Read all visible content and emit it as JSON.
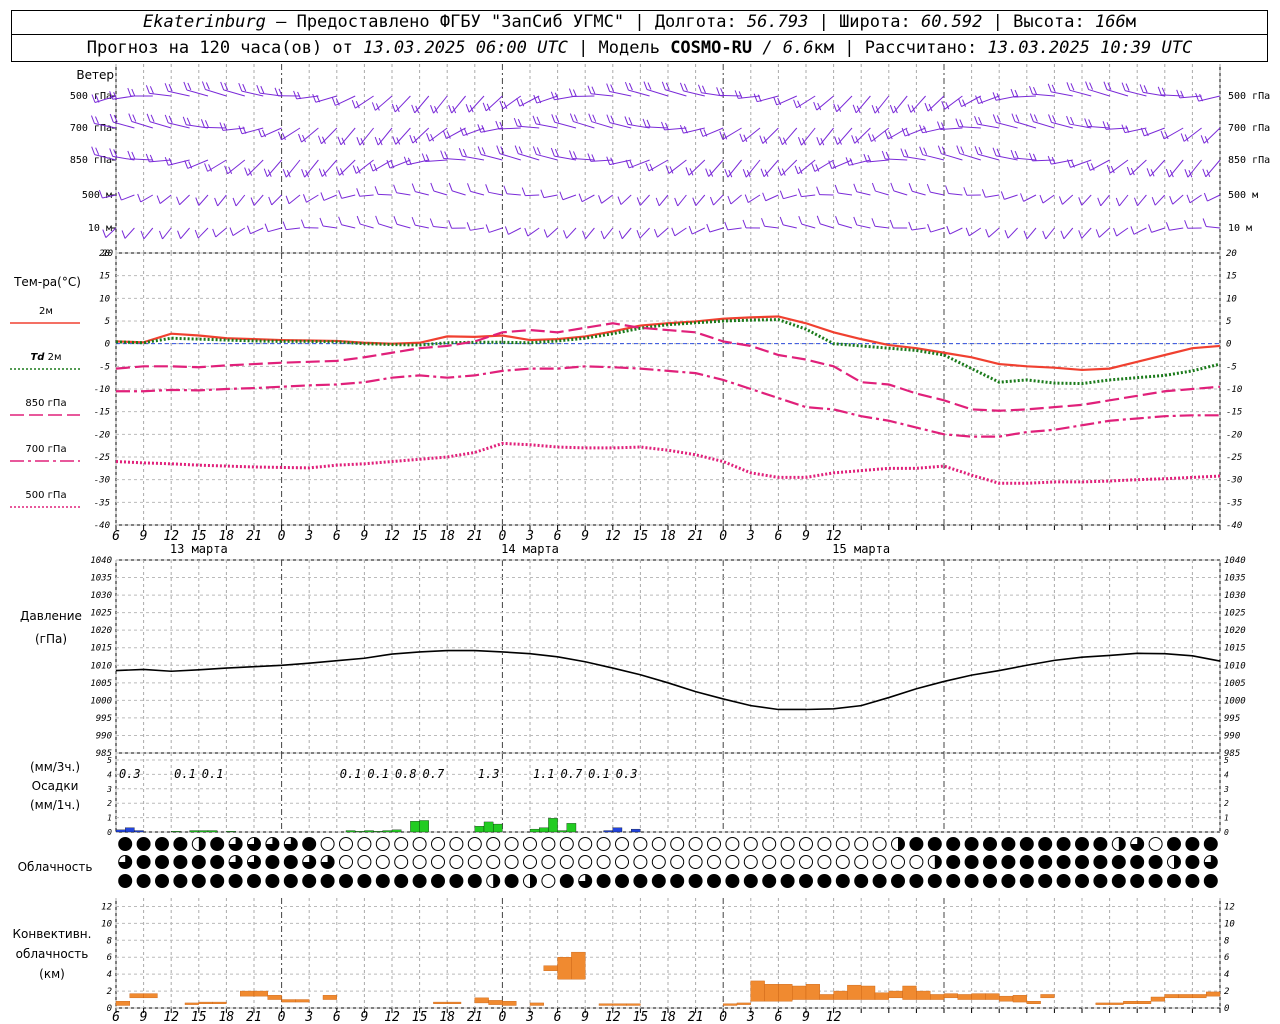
{
  "header": {
    "station": "Ekaterinburg",
    "provider": " – Предоставлено ФГБУ \"ЗапСиб УГМС\" ",
    "lon_label": "| Долгота: ",
    "lon": "56.793",
    "lat_label": " | Широта: ",
    "lat": "60.592",
    "alt_label": " | Высота: ",
    "alt": "166",
    "alt_unit": "м",
    "forecast_label": "Прогноз на 120 часа(ов) от ",
    "forecast_from": "13.03.2025 06:00 UTC",
    "model_label": "  | Модель ",
    "model": "COSMO-RU",
    "res": " / 6.6",
    "res_unit": "км",
    "calc_label": " | Рассчитано: ",
    "calc": "13.03.2025 10:39 UTC"
  },
  "labels": {
    "wind": "Ветер",
    "wind_levels": [
      "500 гПа",
      "700 гПа",
      "850 гПа",
      "500 м",
      "10 м"
    ],
    "temp": "Тем-ра(°С)",
    "t2m": "2м",
    "td": "Td",
    "td2m": "2м",
    "t850": "850 гПа",
    "t700": "700 гПа",
    "t500": "500 гПа",
    "pressure": "Давление",
    "pressure_unit": "(гПа)",
    "precip_unit1": "(мм/3ч.)",
    "precip": "Осадки",
    "precip_unit2": "(мм/1ч.)",
    "cloud": "Облачность",
    "conv1": "Конвективн.",
    "conv2": "облачность",
    "conv3": "(км)"
  },
  "time_axis": {
    "hour_ticks": [
      "6",
      "9",
      "12",
      "15",
      "18",
      "21",
      "0",
      "3",
      "6",
      "9",
      "12",
      "15",
      "18",
      "21",
      "0",
      "3",
      "6",
      "9",
      "12",
      "15",
      "18",
      "21",
      "0",
      "3",
      "6",
      "9",
      "12"
    ],
    "dates": [
      "13 марта",
      "14 марта",
      "15 марта"
    ]
  },
  "chart_data": [
    {
      "type": "line",
      "title": "Тем-ра(°С)",
      "ylim": [
        -40,
        20
      ],
      "yticks": [
        "20",
        "15",
        "10",
        "5",
        "0",
        "-5",
        "-10",
        "-15",
        "-20",
        "-25",
        "-30",
        "-35",
        "-40"
      ],
      "x_hours": [
        0,
        3,
        6,
        9,
        12,
        15,
        18,
        21,
        24,
        27,
        30,
        33,
        36,
        39,
        42,
        45,
        48,
        51,
        54,
        57,
        60,
        63,
        66,
        69,
        72,
        75,
        78,
        81,
        84,
        87,
        90,
        93,
        96,
        99,
        102,
        105,
        108,
        111,
        114,
        117,
        120
      ],
      "series": [
        {
          "name": "2м",
          "color": "#f04030",
          "style": "solid",
          "values": [
            0.5,
            0.3,
            2.2,
            1.8,
            1.2,
            1.0,
            0.8,
            0.7,
            0.6,
            0.2,
            0.0,
            0.2,
            1.6,
            1.5,
            1.8,
            0.8,
            1.0,
            1.6,
            2.7,
            4.0,
            4.5,
            4.9,
            5.5,
            5.8,
            6.0,
            4.5,
            2.5,
            1.0,
            -0.3,
            -1.0,
            -2.0,
            -3.0,
            -4.5,
            -5.0,
            -5.3,
            -5.8,
            -5.5,
            -4.0,
            -2.5,
            -1.0,
            -0.5
          ]
        },
        {
          "name": "Td 2м",
          "color": "#1a7a1a",
          "style": "dotted",
          "values": [
            0.4,
            0.2,
            1.2,
            1.0,
            0.8,
            0.6,
            0.5,
            0.5,
            0.4,
            0.0,
            -0.2,
            -0.3,
            0.2,
            0.3,
            0.3,
            0.2,
            0.6,
            1.2,
            2.2,
            3.4,
            4.2,
            4.6,
            5.0,
            5.2,
            5.3,
            3.2,
            0.0,
            -0.5,
            -1.0,
            -1.5,
            -2.5,
            -5.5,
            -8.5,
            -8.0,
            -8.7,
            -8.8,
            -8.0,
            -7.5,
            -7.0,
            -6.0,
            -4.5
          ]
        },
        {
          "name": "850 гПа",
          "color": "#e0207a",
          "style": "longdash",
          "values": [
            -5.5,
            -5.0,
            -5.0,
            -5.2,
            -4.8,
            -4.5,
            -4.2,
            -4.0,
            -3.8,
            -3.0,
            -2.0,
            -1.0,
            -0.5,
            0.5,
            2.5,
            3.0,
            2.5,
            3.5,
            4.5,
            3.5,
            3.0,
            2.5,
            0.5,
            -0.5,
            -2.5,
            -3.5,
            -5.0,
            -8.5,
            -9.0,
            -11.0,
            -12.5,
            -14.5,
            -14.8,
            -14.5,
            -14.0,
            -13.5,
            -12.5,
            -11.5,
            -10.5,
            -10.0,
            -9.5
          ]
        },
        {
          "name": "700 гПа",
          "color": "#e0207a",
          "style": "dashdot",
          "values": [
            -10.5,
            -10.5,
            -10.2,
            -10.3,
            -10.0,
            -9.8,
            -9.5,
            -9.2,
            -9.0,
            -8.5,
            -7.5,
            -7.0,
            -7.5,
            -7.0,
            -6.0,
            -5.5,
            -5.5,
            -5.0,
            -5.2,
            -5.5,
            -6.0,
            -6.5,
            -8.0,
            -10.0,
            -12.0,
            -14.0,
            -14.5,
            -16.0,
            -17.0,
            -18.5,
            -20.0,
            -20.5,
            -20.5,
            -19.5,
            -19.0,
            -18.0,
            -17.0,
            -16.5,
            -16.0,
            -15.8,
            -15.8
          ]
        },
        {
          "name": "500 гПа",
          "color": "#e0207a",
          "style": "dotted",
          "values": [
            -26.0,
            -26.3,
            -26.5,
            -26.8,
            -27.0,
            -27.2,
            -27.3,
            -27.4,
            -26.8,
            -26.5,
            -26.0,
            -25.5,
            -25.0,
            -24.0,
            -22.0,
            -22.3,
            -22.8,
            -23.0,
            -23.0,
            -22.8,
            -23.5,
            -24.5,
            -26.0,
            -28.5,
            -29.5,
            -29.5,
            -28.5,
            -28.0,
            -27.5,
            -27.5,
            -27.0,
            -29.0,
            -30.8,
            -30.8,
            -30.5,
            -30.5,
            -30.3,
            -30.0,
            -29.8,
            -29.5,
            -29.2
          ]
        }
      ]
    },
    {
      "type": "line",
      "title": "Давление",
      "ylabel": "(гПа)",
      "ylim": [
        985,
        1040
      ],
      "yticks": [
        "1040",
        "1035",
        "1030",
        "1025",
        "1020",
        "1015",
        "1010",
        "1005",
        "1000",
        "995",
        "990",
        "985"
      ],
      "x_hours": [
        0,
        3,
        6,
        9,
        12,
        15,
        18,
        21,
        24,
        27,
        30,
        33,
        36,
        39,
        42,
        45,
        48,
        51,
        54,
        57,
        60,
        63,
        66,
        69,
        72,
        75,
        78,
        81,
        84,
        87,
        90,
        93,
        96,
        99,
        102,
        105,
        108,
        111,
        114,
        117,
        120
      ],
      "series": [
        {
          "name": "",
          "color": "#000000",
          "values": [
            1008.5,
            1008.8,
            1008.3,
            1008.7,
            1009.2,
            1009.6,
            1010.0,
            1010.6,
            1011.3,
            1012.0,
            1013.2,
            1013.8,
            1014.2,
            1014.2,
            1013.8,
            1013.3,
            1012.4,
            1011.0,
            1009.2,
            1007.3,
            1005.0,
            1002.5,
            1000.4,
            998.5,
            997.4,
            997.4,
            997.6,
            998.5,
            1000.8,
            1003.3,
            1005.4,
            1007.2,
            1008.5,
            1010.0,
            1011.4,
            1012.3,
            1012.8,
            1013.4,
            1013.3,
            1012.7,
            1011.2
          ]
        }
      ]
    },
    {
      "type": "bar",
      "title": "Осадки",
      "ylim": [
        0,
        5
      ],
      "yticks": [
        "5",
        "4",
        "3",
        "2",
        "1",
        "0"
      ],
      "totals_3h": [
        {
          "x_hour": 1.5,
          "label": "0.3"
        },
        {
          "x_hour": 7.5,
          "label": "0.1"
        },
        {
          "x_hour": 10.5,
          "label": "0.1"
        },
        {
          "x_hour": 25.5,
          "label": "0.1"
        },
        {
          "x_hour": 28.5,
          "label": "0.1"
        },
        {
          "x_hour": 31.5,
          "label": "0.8"
        },
        {
          "x_hour": 34.5,
          "label": "0.7"
        },
        {
          "x_hour": 40.5,
          "label": "1.3"
        },
        {
          "x_hour": 46.5,
          "label": "1.1"
        },
        {
          "x_hour": 49.5,
          "label": "0.7"
        },
        {
          "x_hour": 52.5,
          "label": "0.1"
        },
        {
          "x_hour": 55.5,
          "label": "0.3"
        }
      ],
      "bars_1h": [
        {
          "x_hour": 0,
          "value": 0.15,
          "color": "#2244dd"
        },
        {
          "x_hour": 1,
          "value": 0.3,
          "color": "#2244dd"
        },
        {
          "x_hour": 2,
          "value": 0.1,
          "color": "#2244dd"
        },
        {
          "x_hour": 6,
          "value": 0.05,
          "color": "#22cc22"
        },
        {
          "x_hour": 8,
          "value": 0.1,
          "color": "#22cc22"
        },
        {
          "x_hour": 9,
          "value": 0.1,
          "color": "#22cc22"
        },
        {
          "x_hour": 10,
          "value": 0.1,
          "color": "#22cc22"
        },
        {
          "x_hour": 12,
          "value": 0.05,
          "color": "#22cc22"
        },
        {
          "x_hour": 25,
          "value": 0.1,
          "color": "#22cc22"
        },
        {
          "x_hour": 26,
          "value": 0.05,
          "color": "#22cc22"
        },
        {
          "x_hour": 27,
          "value": 0.1,
          "color": "#22cc22"
        },
        {
          "x_hour": 28,
          "value": 0.05,
          "color": "#22cc22"
        },
        {
          "x_hour": 29,
          "value": 0.1,
          "color": "#22cc22"
        },
        {
          "x_hour": 30,
          "value": 0.15,
          "color": "#22cc22"
        },
        {
          "x_hour": 32,
          "value": 0.75,
          "color": "#22cc22"
        },
        {
          "x_hour": 33,
          "value": 0.8,
          "color": "#22cc22"
        },
        {
          "x_hour": 39,
          "value": 0.4,
          "color": "#22cc22"
        },
        {
          "x_hour": 40,
          "value": 0.7,
          "color": "#22cc22"
        },
        {
          "x_hour": 41,
          "value": 0.55,
          "color": "#22cc22"
        },
        {
          "x_hour": 45,
          "value": 0.2,
          "color": "#22cc22"
        },
        {
          "x_hour": 46,
          "value": 0.3,
          "color": "#22cc22"
        },
        {
          "x_hour": 47,
          "value": 0.95,
          "color": "#22cc22"
        },
        {
          "x_hour": 48,
          "value": 0.1,
          "color": "#22cc22"
        },
        {
          "x_hour": 49,
          "value": 0.6,
          "color": "#22cc22"
        },
        {
          "x_hour": 53,
          "value": 0.1,
          "color": "#2244dd"
        },
        {
          "x_hour": 54,
          "value": 0.3,
          "color": "#2244dd"
        },
        {
          "x_hour": 56,
          "value": 0.2,
          "color": "#2244dd"
        }
      ]
    },
    {
      "type": "bar",
      "title": "Конвективн. облачность",
      "ylabel": "(км)",
      "ylim": [
        0,
        13
      ],
      "yticks": [
        "12",
        "10",
        "8",
        "6",
        "4",
        "2",
        "0"
      ],
      "bars": [
        {
          "x_hour": 0,
          "base": 0.3,
          "top": 0.8
        },
        {
          "x_hour": 1,
          "base": 1.2,
          "top": 1.7
        },
        {
          "x_hour": 2,
          "base": 1.2,
          "top": 1.7
        },
        {
          "x_hour": 5,
          "base": 0.4,
          "top": 0.6
        },
        {
          "x_hour": 6,
          "base": 0.5,
          "top": 0.7
        },
        {
          "x_hour": 7,
          "base": 0.5,
          "top": 0.7
        },
        {
          "x_hour": 9,
          "base": 1.4,
          "top": 2.0
        },
        {
          "x_hour": 10,
          "base": 1.4,
          "top": 2.0
        },
        {
          "x_hour": 11,
          "base": 1.0,
          "top": 1.5
        },
        {
          "x_hour": 12,
          "base": 0.7,
          "top": 1.0
        },
        {
          "x_hour": 13,
          "base": 0.7,
          "top": 1.0
        },
        {
          "x_hour": 15,
          "base": 1.0,
          "top": 1.5
        },
        {
          "x_hour": 23,
          "base": 0.5,
          "top": 0.7
        },
        {
          "x_hour": 24,
          "base": 0.5,
          "top": 0.7
        },
        {
          "x_hour": 26,
          "base": 0.6,
          "top": 1.2
        },
        {
          "x_hour": 27,
          "base": 0.4,
          "top": 0.9
        },
        {
          "x_hour": 28,
          "base": 0.3,
          "top": 0.8
        },
        {
          "x_hour": 30,
          "base": 0.3,
          "top": 0.6
        },
        {
          "x_hour": 31,
          "base": 4.4,
          "top": 5.0
        },
        {
          "x_hour": 32,
          "base": 3.4,
          "top": 6.0
        },
        {
          "x_hour": 33,
          "base": 3.4,
          "top": 6.6
        },
        {
          "x_hour": 35,
          "base": 0.3,
          "top": 0.5
        },
        {
          "x_hour": 36,
          "base": 0.3,
          "top": 0.5
        },
        {
          "x_hour": 37,
          "base": 0.3,
          "top": 0.5
        },
        {
          "x_hour": 44,
          "base": 0.3,
          "top": 0.5
        },
        {
          "x_hour": 45,
          "base": 0.4,
          "top": 0.6
        },
        {
          "x_hour": 46,
          "base": 0.8,
          "top": 3.2
        },
        {
          "x_hour": 47,
          "base": 0.8,
          "top": 2.8
        },
        {
          "x_hour": 48,
          "base": 0.8,
          "top": 2.8
        },
        {
          "x_hour": 49,
          "base": 1.0,
          "top": 2.6
        },
        {
          "x_hour": 50,
          "base": 1.0,
          "top": 2.8
        },
        {
          "x_hour": 51,
          "base": 1.0,
          "top": 1.6
        },
        {
          "x_hour": 52,
          "base": 1.0,
          "top": 2.0
        },
        {
          "x_hour": 53,
          "base": 1.0,
          "top": 2.7
        },
        {
          "x_hour": 54,
          "base": 1.0,
          "top": 2.6
        },
        {
          "x_hour": 55,
          "base": 1.0,
          "top": 1.8
        },
        {
          "x_hour": 56,
          "base": 1.2,
          "top": 2.0
        },
        {
          "x_hour": 57,
          "base": 1.0,
          "top": 2.6
        },
        {
          "x_hour": 58,
          "base": 1.0,
          "top": 2.0
        },
        {
          "x_hour": 59,
          "base": 1.0,
          "top": 1.6
        },
        {
          "x_hour": 60,
          "base": 1.2,
          "top": 1.7
        },
        {
          "x_hour": 61,
          "base": 1.0,
          "top": 1.6
        },
        {
          "x_hour": 62,
          "base": 1.0,
          "top": 1.7
        },
        {
          "x_hour": 63,
          "base": 1.0,
          "top": 1.7
        },
        {
          "x_hour": 64,
          "base": 0.8,
          "top": 1.4
        },
        {
          "x_hour": 65,
          "base": 0.7,
          "top": 1.5
        },
        {
          "x_hour": 66,
          "base": 0.5,
          "top": 0.8
        },
        {
          "x_hour": 67,
          "base": 1.2,
          "top": 1.6
        },
        {
          "x_hour": 71,
          "base": 0.4,
          "top": 0.6
        },
        {
          "x_hour": 72,
          "base": 0.4,
          "top": 0.6
        },
        {
          "x_hour": 73,
          "base": 0.5,
          "top": 0.8
        },
        {
          "x_hour": 74,
          "base": 0.5,
          "top": 0.8
        },
        {
          "x_hour": 75,
          "base": 0.8,
          "top": 1.3
        },
        {
          "x_hour": 76,
          "base": 1.2,
          "top": 1.6
        },
        {
          "x_hour": 77,
          "base": 1.2,
          "top": 1.6
        },
        {
          "x_hour": 78,
          "base": 1.2,
          "top": 1.6
        },
        {
          "x_hour": 79,
          "base": 1.4,
          "top": 1.9
        }
      ]
    }
  ],
  "cloud_rows": {
    "row1": "FFFFHFQQQQF0000000000000000000000000000000HFFFFFFFFFFFHQ0FFFFFFFFFFFFFFHQFFFFFFFFFFF00000000HFQ0000000000000000000000000000000000000000000000",
    "row2": "QFFFFFQQFFQQ00000000000000000000000000000000HFFFFFFFFFFFFHFQFFFFFFFFFFFFFFHFFFFFFFFFFFFF0HFQ0FFFFFFFH00000000000000000000000000000000000000",
    "row3": "FFFFFFFFFFFFFFFFFFFFHFH0FQFFFFFFFFFFFFFFFFFFFFFFFFFFFFFFFFFFFFFFFFFFFFFFFFFFFFFFFFFFFFFFFFFFFF0HHF0FQQ00000HFFFFF"
  }
}
